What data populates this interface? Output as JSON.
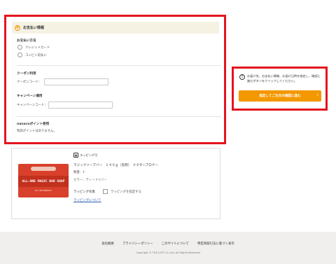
{
  "payment": {
    "header_title": "お支払い情報",
    "method_title": "お支払い方法",
    "options": [
      "クレジットカード",
      "コンビニ前払い"
    ],
    "coupon_title": "クーポン利用",
    "coupon_label": "クーポンコード：",
    "campaign_title": "キャンペーン適用",
    "campaign_label": "キャンペーンコード：",
    "nanaco_title": "nanacoポイント使用",
    "nanaco_note": "残高ポイントはありません。"
  },
  "notice": {
    "message": "お届け先、お支払い情報、お届け日時を指定し、確認に進むボタンをクリックしてください。",
    "button_label": "指定してご注文の確認に進む"
  },
  "product": {
    "image_label": "ALL-ONE MAGIC BAR SOAP",
    "image_brand": "DR. BRONNER'S",
    "wrap_badge": "ラッピング可",
    "name": "マジックソープバー　１４０ｇ（名称）　ドクターブロナー",
    "quantity": "数量：1",
    "color": "カラー：ティートゥリー",
    "wrap_label": "ラッピング有無",
    "wrap_checkbox": "ラッピングを指定する",
    "wrap_link": "ラッピングについて"
  },
  "footer": {
    "links": [
      "会社概要",
      "プライバシーポリシー",
      "このサイトについて",
      "特定商取引法に基づく表示"
    ],
    "copyright": "Copyright © THE LOFT Co.,Ltd. All Rights Reserved"
  },
  "colors": {
    "highlight_border": "#e4141e",
    "accent": "#f39800",
    "header_bg": "#f5f2e4",
    "footer_bg": "#f0efed",
    "link": "#2a5db0"
  },
  "icons": {
    "header": "info-circle-icon",
    "notice": "exclamation-circle-icon",
    "button": "chevron-right-icon",
    "badge": "gift-icon"
  }
}
